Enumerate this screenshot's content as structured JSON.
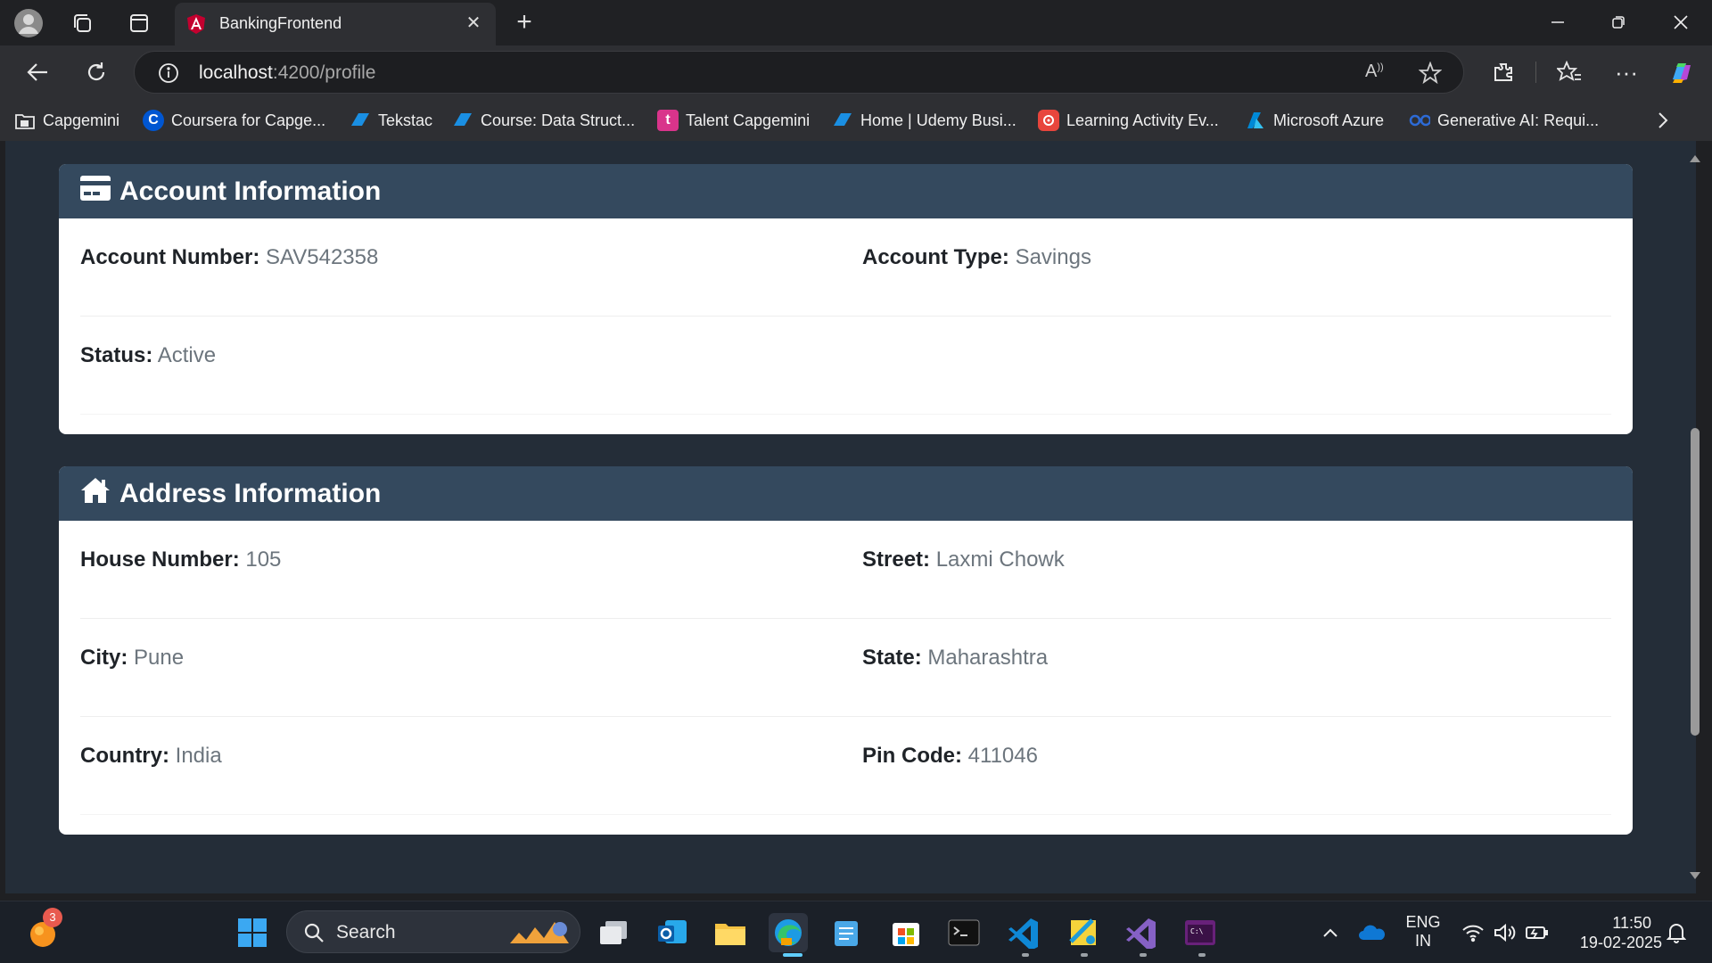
{
  "browser": {
    "tab_title": "BankingFrontend",
    "url_host": "localhost",
    "url_path": ":4200/profile"
  },
  "bookmarks": [
    {
      "label": "Capgemini",
      "icon": "folder-icon",
      "color": "#2e2f33"
    },
    {
      "label": "Coursera for Capge...",
      "icon": "coursera-icon",
      "color": "#0056d2"
    },
    {
      "label": "Tekstac",
      "icon": "tekstac-icon",
      "color": "#1a8fe3"
    },
    {
      "label": "Course: Data Struct...",
      "icon": "course-icon",
      "color": "#1a8fe3"
    },
    {
      "label": "Talent Capgemini",
      "icon": "talent-icon",
      "color": "#d9348b"
    },
    {
      "label": "Home | Udemy Busi...",
      "icon": "udemy-icon",
      "color": "#1a8fe3"
    },
    {
      "label": "Learning Activity Ev...",
      "icon": "learning-icon",
      "color": "#e8453c"
    },
    {
      "label": "Microsoft Azure",
      "icon": "azure-icon",
      "color": "#0089d6"
    },
    {
      "label": "Generative AI: Requi...",
      "icon": "genai-icon",
      "color": "#2d6bd6"
    }
  ],
  "account": {
    "title": "Account Information",
    "account_number_label": "Account Number:",
    "account_number": "SAV542358",
    "account_type_label": "Account Type:",
    "account_type": "Savings",
    "status_label": "Status:",
    "status": "Active"
  },
  "address": {
    "title": "Address Information",
    "house_number_label": "House Number:",
    "house_number": "105",
    "street_label": "Street:",
    "street": "Laxmi Chowk",
    "city_label": "City:",
    "city": "Pune",
    "state_label": "State:",
    "state": "Maharashtra",
    "country_label": "Country:",
    "country": "India",
    "pin_code_label": "Pin Code:",
    "pin_code": "411046"
  },
  "taskbar": {
    "search_label": "Search",
    "notification_badge": "3",
    "lang_line1": "ENG",
    "lang_line2": "IN",
    "time": "11:50",
    "date": "19-02-2025"
  },
  "colors": {
    "card_header": "#34495e",
    "page_bg": "#242d38",
    "value_text": "#6c757d"
  }
}
